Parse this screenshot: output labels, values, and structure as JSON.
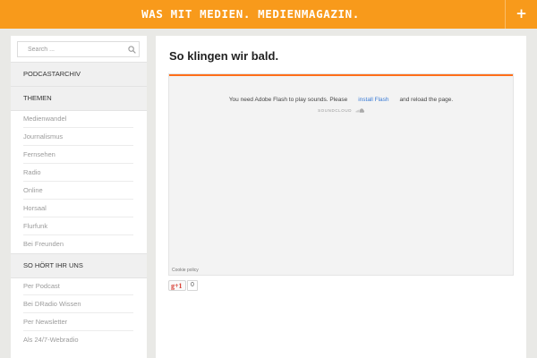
{
  "header": {
    "site_title": "WAS MIT MEDIEN. MEDIENMAGAZIN.",
    "plus_label": "+"
  },
  "sidebar": {
    "search": {
      "placeholder": "Search ...",
      "value": ""
    },
    "sections": [
      {
        "label": "PODCASTARCHIV",
        "items": []
      },
      {
        "label": "THEMEN",
        "items": [
          "Medienwandel",
          "Journalismus",
          "Fernsehen",
          "Radio",
          "Online",
          "Horsaal",
          "Flurfunk",
          "Bei Freunden"
        ]
      },
      {
        "label": "SO HÖRT IHR UNS",
        "items": [
          "Per Podcast",
          "Bei DRadio Wissen",
          "Per Newsletter",
          "Als 24/7-Webradio"
        ]
      }
    ]
  },
  "main": {
    "post_title": "So klingen wir bald.",
    "player": {
      "message_before": "You need Adobe Flash to play sounds. Please",
      "link_text": "install Flash",
      "message_after": "and reload the page.",
      "brand": "SOUNDCLOUD",
      "cookie_policy": "Cookie policy",
      "accent_color": "#ff6f1a"
    },
    "share": {
      "gplus_label": "g+1",
      "gplus_count": "0"
    }
  },
  "colors": {
    "header": "#f89a1b",
    "background": "#e9e9e6",
    "link": "#3a7bd5"
  }
}
